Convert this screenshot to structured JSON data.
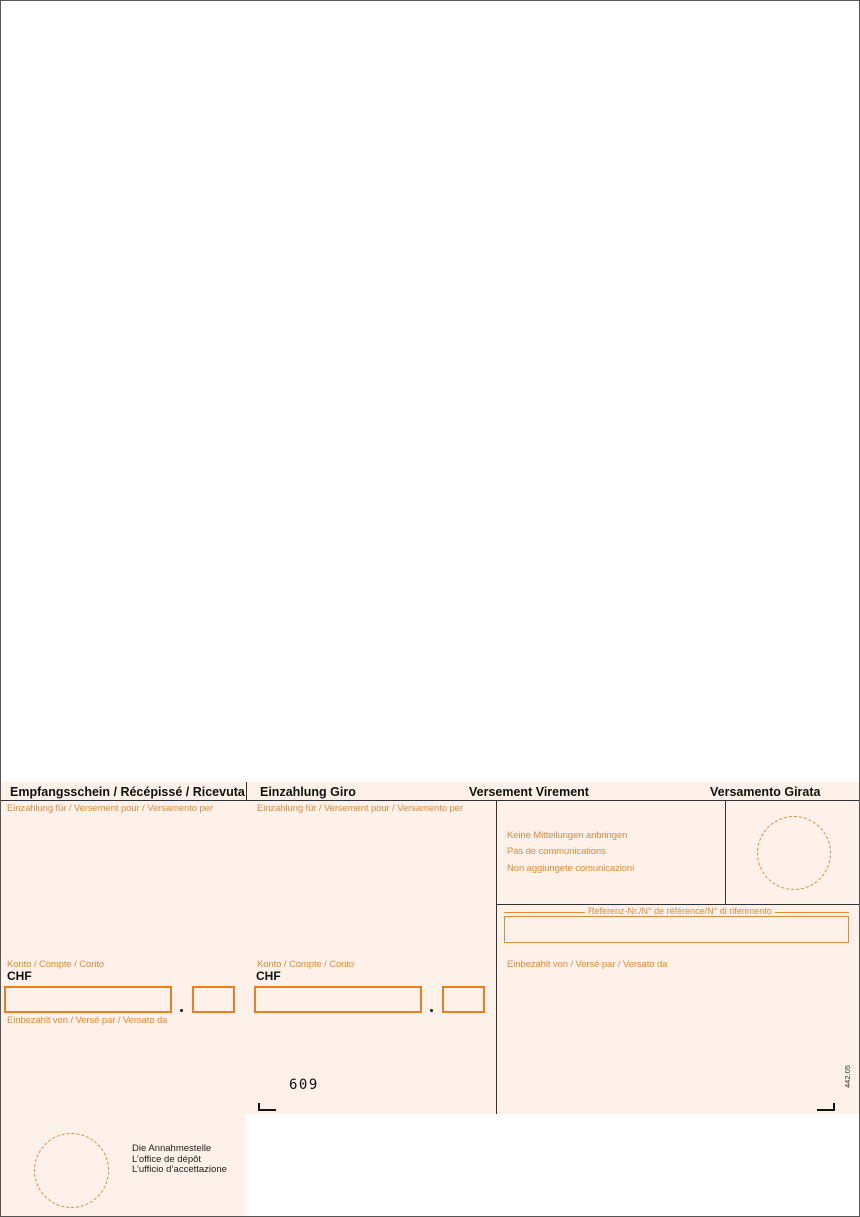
{
  "receipt": {
    "title": "Empfangsschein / Récépissé / Ricevuta",
    "payable_to_label": "Einzahlung für / Versement pour / Versamento per",
    "account_label": "Konto / Compte / Conto",
    "currency": "CHF",
    "paid_by_label": "Einbezahlt von / Versé par / Versato da",
    "office_lines": [
      "Die Annahmestelle",
      "L’office de dépôt",
      "L’ufficio d’accettazione"
    ]
  },
  "payment": {
    "title_de": "Einzahlung Giro",
    "title_fr": "Versement Virement",
    "title_it": "Versamento Girata",
    "payable_to_label": "Einzahlung für / Versement pour / Versamento per",
    "account_label": "Konto / Compte / Conto",
    "currency": "CHF",
    "no_messages": [
      "Keine Mitteilungen anbringen",
      "Pas de communications",
      "Non aggiungete comunicazioni"
    ],
    "reference_label": "Referenz-Nr./N° de référence/N° di riferimento",
    "paid_by_label": "Einbezahlt von / Versé par / Versato da",
    "code": "609",
    "form_number": "442.05"
  },
  "colors": {
    "slip_background": "#fdf1e9",
    "accent_orange": "#e8801f",
    "label_orange": "#e38b3a"
  }
}
